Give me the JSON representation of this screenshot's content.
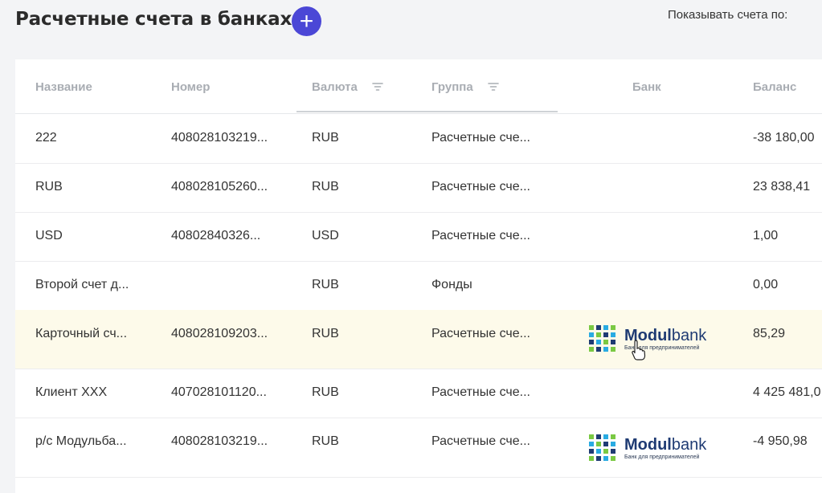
{
  "header": {
    "title": "Расчетные счета в банках",
    "add_label": "+",
    "show_accounts_label": "Показывать счета по:"
  },
  "table": {
    "columns": [
      "Название",
      "Номер",
      "Валюта",
      "Группа",
      "Банк",
      "Баланс"
    ],
    "rows": [
      {
        "name": "222",
        "number": "408028103219...",
        "currency": "RUB",
        "group": "Расчетные сче...",
        "bank": "",
        "balance": "-38 180,00"
      },
      {
        "name": "RUB",
        "number": "408028105260...",
        "currency": "RUB",
        "group": "Расчетные сче...",
        "bank": "",
        "balance": "23 838,41"
      },
      {
        "name": "USD",
        "number": "40802840326...",
        "currency": "USD",
        "group": "Расчетные сче...",
        "bank": "",
        "balance": "1,00"
      },
      {
        "name": "Второй счет д...",
        "number": "",
        "currency": "RUB",
        "group": "Фонды",
        "bank": "",
        "balance": "0,00"
      },
      {
        "name": "Карточный сч...",
        "number": "408028109203...",
        "currency": "RUB",
        "group": "Расчетные сче...",
        "bank": "modulbank",
        "balance": "85,29"
      },
      {
        "name": "Клиент ХХХ",
        "number": "407028101120...",
        "currency": "RUB",
        "group": "Расчетные сче...",
        "bank": "",
        "balance": "4 425 481,0"
      },
      {
        "name": "р/с Модульба...",
        "number": "408028103219...",
        "currency": "RUB",
        "group": "Расчетные сче...",
        "bank": "modulbank",
        "balance": "-4 950,98"
      }
    ]
  },
  "bank_logo": {
    "brand_bold": "Modul",
    "brand_light": "bank",
    "tagline": "Банк для предпринимателей"
  },
  "colors": {
    "accent": "#4b47d6",
    "highlight_row": "#fdfaea",
    "header_text": "#a9adb3"
  }
}
